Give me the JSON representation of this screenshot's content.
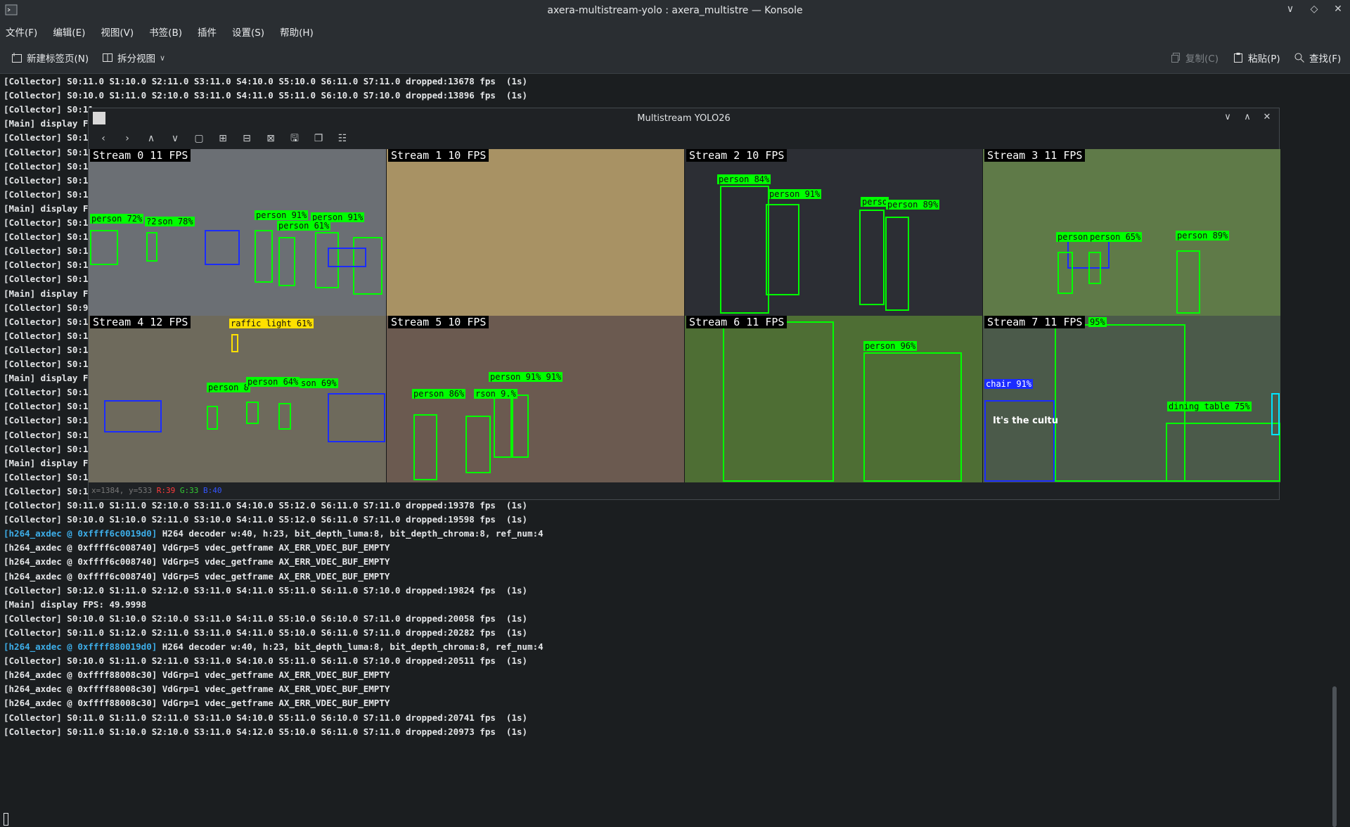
{
  "window": {
    "title": "axera-multistream-yolo : axera_multistre — Konsole"
  },
  "menu": [
    "文件(F)",
    "编辑(E)",
    "视图(V)",
    "书签(B)",
    "插件",
    "设置(S)",
    "帮助(H)"
  ],
  "toolbar": {
    "new_tab": "新建标签页(N)",
    "split_view": "拆分视图",
    "copy": "复制(C)",
    "paste": "粘贴(P)",
    "find": "查找(F)"
  },
  "terminal_lines": [
    "[Collector] S0:11.0 S1:10.0 S2:11.0 S3:11.0 S4:10.0 S5:10.0 S6:11.0 S7:11.0 dropped:13678 fps  (1s)",
    "[Collector] S0:10.0 S1:11.0 S2:10.0 S3:11.0 S4:11.0 S5:11.0 S6:10.0 S7:10.0 dropped:13896 fps  (1s)",
    "[Collector] S0:11",
    "[Main] display FP",
    "[Collector] S0:11",
    "[Collector] S0:11",
    "[Collector] S0:10",
    "[Collector] S0:11",
    "[Collector] S0:11",
    "[Main] display FP",
    "[Collector] S0:11",
    "[Collector] S0:10",
    "[Collector] S0:11",
    "[Collector] S0:10",
    "[Collector] S0:11",
    "[Main] display FP",
    "[Collector] S0:9.",
    "[Collector] S0:11",
    "[Collector] S0:11",
    "[Collector] S0:10",
    "[Collector] S0:11",
    "[Main] display FP",
    "[Collector] S0:11",
    "[Collector] S0:11",
    "[Collector] S0:10",
    "[Collector] S0:10",
    "[Collector] S0:11",
    "[Main] display FP",
    "[Collector] S0:11",
    "[Collector] S0:10",
    "[Collector] S0:11.0 S1:11.0 S2:10.0 S3:11.0 S4:10.0 S5:12.0 S6:11.0 S7:11.0 dropped:19378 fps  (1s)",
    "[Collector] S0:10.0 S1:10.0 S2:11.0 S3:10.0 S4:11.0 S5:12.0 S6:11.0 S7:11.0 dropped:19598 fps  (1s)"
  ],
  "terminal_lines_b": [
    {
      "prefix": "[h264_axdec @ 0xffff6c0019d0]",
      "text": " H264 decoder w:40, h:23, bit_depth_luma:8, bit_depth_chroma:8, ref_num:4",
      "blue": true
    },
    {
      "prefix": "[h264_axdec @ 0xffff6c008740]",
      "text": " VdGrp=5 vdec_getframe AX_ERR_VDEC_BUF_EMPTY",
      "blue": false
    },
    {
      "prefix": "[h264_axdec @ 0xffff6c008740]",
      "text": " VdGrp=5 vdec_getframe AX_ERR_VDEC_BUF_EMPTY",
      "blue": false
    },
    {
      "prefix": "[h264_axdec @ 0xffff6c008740]",
      "text": " VdGrp=5 vdec_getframe AX_ERR_VDEC_BUF_EMPTY",
      "blue": false
    },
    {
      "prefix": "",
      "text": "[Collector] S0:12.0 S1:11.0 S2:12.0 S3:11.0 S4:11.0 S5:11.0 S6:11.0 S7:10.0 dropped:19824 fps  (1s)",
      "blue": false
    },
    {
      "prefix": "",
      "text": "[Main] display FPS: 49.9998",
      "blue": false
    },
    {
      "prefix": "",
      "text": "[Collector] S0:10.0 S1:10.0 S2:10.0 S3:11.0 S4:11.0 S5:10.0 S6:10.0 S7:11.0 dropped:20058 fps  (1s)",
      "blue": false
    },
    {
      "prefix": "",
      "text": "[Collector] S0:11.0 S1:12.0 S2:11.0 S3:11.0 S4:11.0 S5:10.0 S6:11.0 S7:11.0 dropped:20282 fps  (1s)",
      "blue": false
    },
    {
      "prefix": "[h264_axdec @ 0xffff880019d0]",
      "text": " H264 decoder w:40, h:23, bit_depth_luma:8, bit_depth_chroma:8, ref_num:4",
      "blue": true
    },
    {
      "prefix": "",
      "text": "[Collector] S0:10.0 S1:11.0 S2:11.0 S3:11.0 S4:10.0 S5:11.0 S6:11.0 S7:10.0 dropped:20511 fps  (1s)",
      "blue": false
    },
    {
      "prefix": "[h264_axdec @ 0xffff88008c30]",
      "text": " VdGrp=1 vdec_getframe AX_ERR_VDEC_BUF_EMPTY",
      "blue": false
    },
    {
      "prefix": "[h264_axdec @ 0xffff88008c30]",
      "text": " VdGrp=1 vdec_getframe AX_ERR_VDEC_BUF_EMPTY",
      "blue": false
    },
    {
      "prefix": "[h264_axdec @ 0xffff88008c30]",
      "text": " VdGrp=1 vdec_getframe AX_ERR_VDEC_BUF_EMPTY",
      "blue": false
    },
    {
      "prefix": "",
      "text": "[Collector] S0:11.0 S1:11.0 S2:11.0 S3:11.0 S4:10.0 S5:11.0 S6:10.0 S7:11.0 dropped:20741 fps  (1s)",
      "blue": false
    },
    {
      "prefix": "",
      "text": "[Collector] S0:11.0 S1:10.0 S2:10.0 S3:11.0 S4:12.0 S5:10.0 S6:11.0 S7:11.0 dropped:20973 fps  (1s)",
      "blue": false
    }
  ],
  "overlay": {
    "title": "Multistream YOLO26",
    "status": {
      "pos": "x=1384, y=533",
      "r": "R:39",
      "g": "G:33",
      "b": "B:40"
    },
    "streams": [
      {
        "label": "Stream 0  11 FPS",
        "bg": "#6b6f74"
      },
      {
        "label": "Stream 1  10 FPS",
        "bg": "#a89264"
      },
      {
        "label": "Stream 2  10 FPS",
        "bg": "#2c2e34"
      },
      {
        "label": "Stream 3  11 FPS",
        "bg": "#5f7a48"
      },
      {
        "label": "Stream 4  12 FPS",
        "bg": "#6e6a5c"
      },
      {
        "label": "Stream 5  10 FPS",
        "bg": "#6b5a50"
      },
      {
        "label": "Stream 6  11 FPS",
        "bg": "#4e6e34"
      },
      {
        "label": "Stream 7  11 FPS",
        "bg": "#4b5a4a"
      }
    ],
    "detections": [
      {
        "s": 0,
        "t": "person 72%",
        "c": "green"
      },
      {
        "s": 0,
        "t": "?2%",
        "c": "green"
      },
      {
        "s": 0,
        "t": "son 78%",
        "c": "green"
      },
      {
        "s": 0,
        "t": "person 91%",
        "c": "green"
      },
      {
        "s": 0,
        "t": "person 91%",
        "c": "green"
      },
      {
        "s": 0,
        "t": "person 61%",
        "c": "green"
      },
      {
        "s": 2,
        "t": "person 84%",
        "c": "green"
      },
      {
        "s": 2,
        "t": "person 91%",
        "c": "green"
      },
      {
        "s": 2,
        "t": "perso",
        "c": "green"
      },
      {
        "s": 2,
        "t": "person 89%",
        "c": "green"
      },
      {
        "s": 3,
        "t": "person",
        "c": "green"
      },
      {
        "s": 3,
        "t": "person 65%",
        "c": "green"
      },
      {
        "s": 3,
        "t": "person 89%",
        "c": "green"
      },
      {
        "s": 4,
        "t": "raffic light 61%",
        "c": "yellow"
      },
      {
        "s": 4,
        "t": "person 8",
        "c": "green"
      },
      {
        "s": 4,
        "t": "person 64%",
        "c": "green"
      },
      {
        "s": 4,
        "t": "son 69%",
        "c": "green"
      },
      {
        "s": 5,
        "t": "person 91% 91%",
        "c": "green"
      },
      {
        "s": 5,
        "t": "person 86%",
        "c": "green"
      },
      {
        "s": 5,
        "t": "rson 9.%",
        "c": "green"
      },
      {
        "s": 6,
        "t": "person 96%",
        "c": "green"
      },
      {
        "s": 7,
        "t": "95%",
        "c": "green"
      },
      {
        "s": 7,
        "t": "chair 91%",
        "c": "blue"
      },
      {
        "s": 7,
        "t": "dining table 75%",
        "c": "green"
      }
    ],
    "caption": "It's the cultu"
  }
}
